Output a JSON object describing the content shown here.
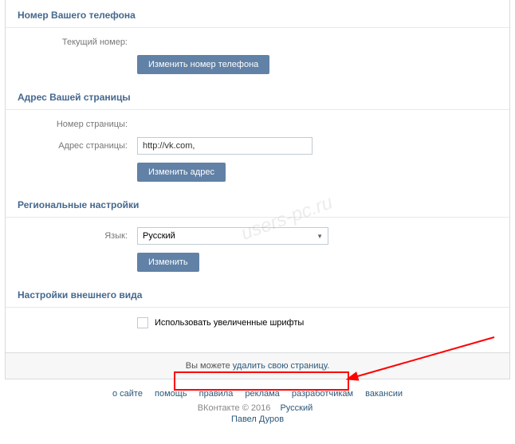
{
  "sections": {
    "phone": {
      "title": "Номер Вашего телефона",
      "current_label": "Текущий номер:",
      "current_value": "",
      "change_btn": "Изменить номер телефона"
    },
    "page_address": {
      "title": "Адрес Вашей страницы",
      "number_label": "Номер страницы:",
      "number_value": "",
      "address_label": "Адрес страницы:",
      "address_value": "http://vk.com,",
      "change_btn": "Изменить адрес"
    },
    "regional": {
      "title": "Региональные настройки",
      "lang_label": "Язык:",
      "lang_value": "Русский",
      "change_btn": "Изменить"
    },
    "appearance": {
      "title": "Настройки внешнего вида",
      "large_fonts": "Использовать увеличенные шрифты"
    }
  },
  "delete_bar": {
    "prefix": "Вы можете ",
    "link": "удалить свою страницу",
    "suffix": "."
  },
  "footer": {
    "links": [
      "о сайте",
      "помощь",
      "правила",
      "реклама",
      "разработчикам",
      "вакансии"
    ],
    "brand": "ВКонтакте",
    "copyright": "© 2016",
    "lang": "Русский",
    "author": "Павел Дуров"
  },
  "watermark": "users-pc.ru"
}
